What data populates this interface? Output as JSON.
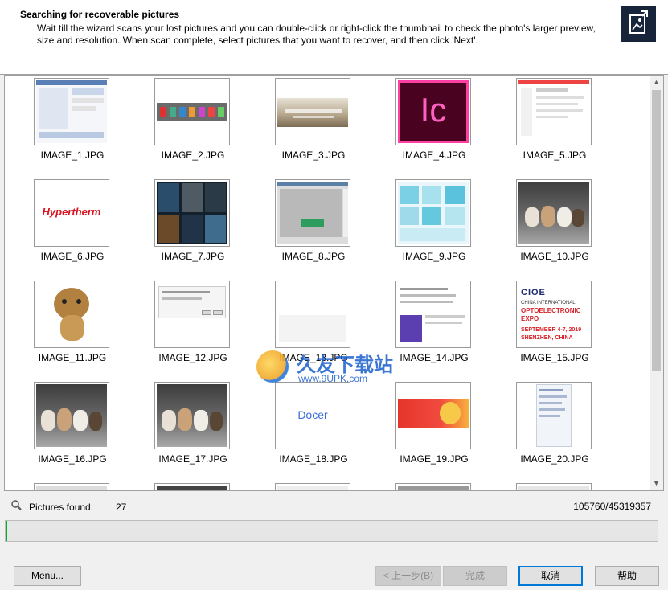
{
  "header": {
    "title": "Searching for recoverable pictures",
    "description": "Wait till the wizard scans your lost pictures and you can double-click or right-click the thumbnail to check the photo's larger preview, size and resolution. When scan complete, select pictures that you want to recover, and then click 'Next'.",
    "icon": "picture-search-icon"
  },
  "thumbnails": [
    {
      "name": "IMAGE_1.JPG"
    },
    {
      "name": "IMAGE_2.JPG"
    },
    {
      "name": "IMAGE_3.JPG"
    },
    {
      "name": "IMAGE_4.JPG"
    },
    {
      "name": "IMAGE_5.JPG"
    },
    {
      "name": "IMAGE_6.JPG"
    },
    {
      "name": "IMAGE_7.JPG"
    },
    {
      "name": "IMAGE_8.JPG"
    },
    {
      "name": "IMAGE_9.JPG"
    },
    {
      "name": "IMAGE_10.JPG"
    },
    {
      "name": "IMAGE_11.JPG"
    },
    {
      "name": "IMAGE_12.JPG"
    },
    {
      "name": "IMAGE_13.JPG"
    },
    {
      "name": "IMAGE_14.JPG"
    },
    {
      "name": "IMAGE_15.JPG"
    },
    {
      "name": "IMAGE_16.JPG"
    },
    {
      "name": "IMAGE_17.JPG"
    },
    {
      "name": "IMAGE_18.JPG"
    },
    {
      "name": "IMAGE_19.JPG"
    },
    {
      "name": "IMAGE_20.JPG"
    }
  ],
  "thumb_text": {
    "ic": "Ic",
    "hypertherm": "Hypertherm",
    "cioe": "CIOE",
    "cioe_line1": "CHINA INTERNATIONAL",
    "cioe_line2": "OPTOELECTRONIC",
    "cioe_line3": "EXPO",
    "cioe_line4": "SEPTEMBER 4-7, 2019",
    "cioe_line5": "SHENZHEN, CHINA",
    "docer": "Docer"
  },
  "status": {
    "found_label": "Pictures found:",
    "found_count": "27",
    "progress_text": "105760/45319357",
    "progress_fraction": 0.0023
  },
  "watermark": {
    "text_cn": "久友下载站",
    "url": "www.9UPK.com"
  },
  "buttons": {
    "menu": "Menu...",
    "back": "< 上一步(B)",
    "finish": "完成",
    "cancel": "取消",
    "help": "帮助"
  },
  "colors": {
    "progress": "#06b025",
    "accent": "#0078d7"
  }
}
